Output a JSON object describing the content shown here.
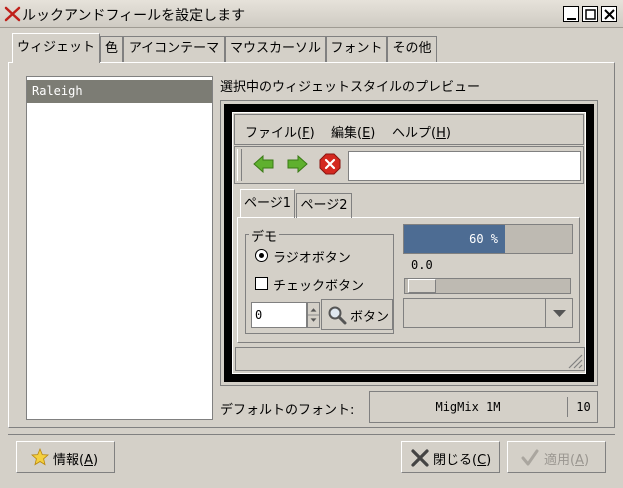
{
  "window": {
    "title": "ルックアンドフィールを設定します"
  },
  "tabs": [
    {
      "label": "ウィジェット"
    },
    {
      "label": "色"
    },
    {
      "label": "アイコンテーマ"
    },
    {
      "label": "マウスカーソル"
    },
    {
      "label": "フォント"
    },
    {
      "label": "その他"
    }
  ],
  "theme_list": {
    "items": [
      "Raleigh"
    ],
    "selected": "Raleigh"
  },
  "preview": {
    "label": "選択中のウィジェットスタイルのプレビュー",
    "menus": [
      {
        "text": "ファイル(",
        "key": "F",
        "end": ")"
      },
      {
        "text": "編集(",
        "key": "E",
        "end": ")"
      },
      {
        "text": "ヘルプ(",
        "key": "H",
        "end": ")"
      }
    ],
    "tabs": [
      "ページ1",
      "ページ2"
    ],
    "demo_legend": "デモ",
    "radio_label": "ラジオボタン",
    "check_label": "チェックボタン",
    "spin_value": "0",
    "button_label": "ボタン",
    "progress": 0.6,
    "progress_text": "60 %",
    "scale_value": "0.0"
  },
  "font": {
    "label": "デフォルトのフォント:",
    "name": "MigMix 1M",
    "size": "10"
  },
  "buttons": {
    "info": {
      "text": "情報(",
      "key": "A",
      "end": ")"
    },
    "close": {
      "text": "閉じる(",
      "key": "C",
      "end": ")"
    },
    "apply": {
      "text": "適用(",
      "key": "A",
      "end": ")"
    }
  },
  "colors": {
    "selection": "#7c7c74",
    "progress": "#4d6c93",
    "arrow_green": "#5fb02e",
    "stop_red": "#d4281f"
  }
}
